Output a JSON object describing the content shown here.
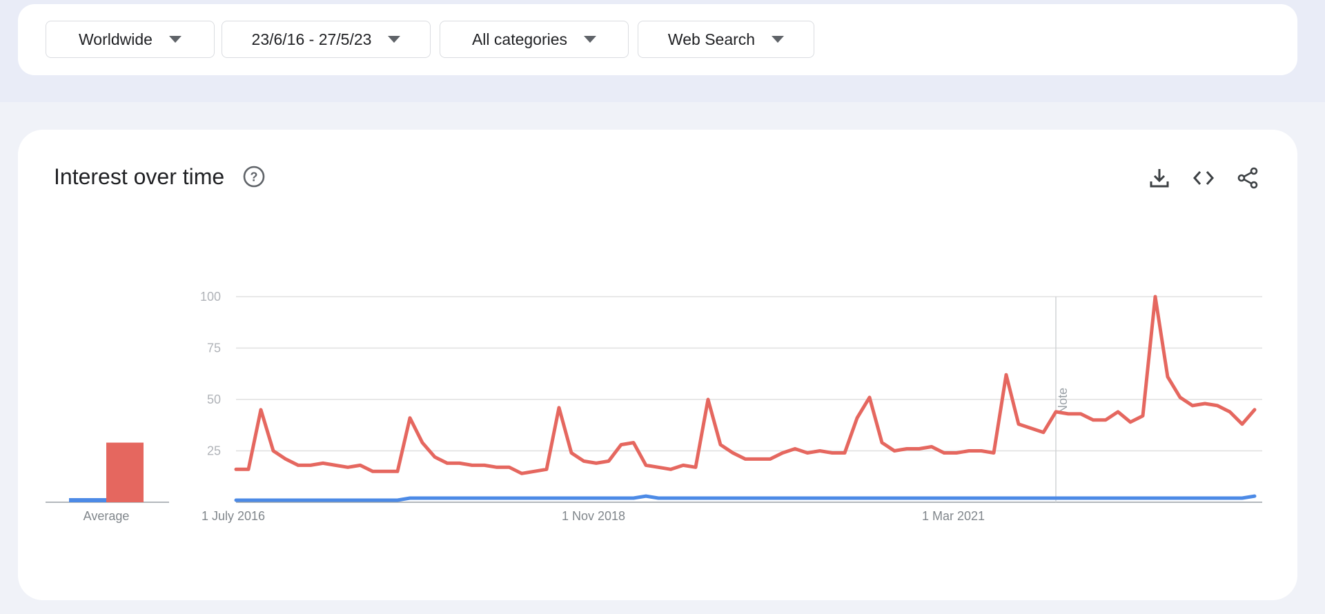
{
  "filters": {
    "region": "Worldwide",
    "date_range": "23/6/16 - 27/5/23",
    "category": "All categories",
    "search_type": "Web Search"
  },
  "card": {
    "title": "Interest over time",
    "icons": [
      "help-icon",
      "download-icon",
      "embed-icon",
      "share-icon"
    ]
  },
  "colors": {
    "red_series": "#e5675f",
    "blue_series": "#4c8ae6",
    "grid": "#e0e0e0",
    "axis_text": "#9aa0a6"
  },
  "chart_data": {
    "type": "line",
    "ylim": [
      0,
      100
    ],
    "yticks": [
      "100",
      "75",
      "50",
      "25"
    ],
    "xtick_labels": [
      "1 July 2016",
      "1 Nov 2018",
      "1 Mar 2021"
    ],
    "note_label": "Note",
    "average_label": "Average",
    "averages": [
      1,
      29
    ],
    "series": [
      {
        "color": "#e5675f",
        "values": [
          16,
          16,
          45,
          25,
          21,
          18,
          18,
          19,
          18,
          17,
          18,
          15,
          15,
          15,
          41,
          29,
          22,
          19,
          19,
          18,
          18,
          17,
          17,
          14,
          15,
          16,
          46,
          24,
          20,
          19,
          20,
          28,
          29,
          18,
          17,
          16,
          18,
          17,
          50,
          28,
          24,
          21,
          21,
          21,
          24,
          26,
          24,
          25,
          24,
          24,
          41,
          51,
          29,
          25,
          26,
          26,
          27,
          24,
          24,
          25,
          25,
          24,
          62,
          38,
          36,
          34,
          44,
          43,
          43,
          40,
          40,
          44,
          39,
          42,
          100,
          61,
          51,
          47,
          48,
          47,
          44,
          38,
          45
        ]
      },
      {
        "color": "#4c8ae6",
        "values": [
          1,
          1,
          1,
          1,
          1,
          1,
          1,
          1,
          1,
          1,
          1,
          1,
          1,
          1,
          2,
          2,
          2,
          2,
          2,
          2,
          2,
          2,
          2,
          2,
          2,
          2,
          2,
          2,
          2,
          2,
          2,
          2,
          2,
          3,
          2,
          2,
          2,
          2,
          2,
          2,
          2,
          2,
          2,
          2,
          2,
          2,
          2,
          2,
          2,
          2,
          2,
          2,
          2,
          2,
          2,
          2,
          2,
          2,
          2,
          2,
          2,
          2,
          2,
          2,
          2,
          2,
          2,
          2,
          2,
          2,
          2,
          2,
          2,
          2,
          2,
          2,
          2,
          2,
          2,
          2,
          2,
          2,
          3
        ]
      }
    ]
  }
}
